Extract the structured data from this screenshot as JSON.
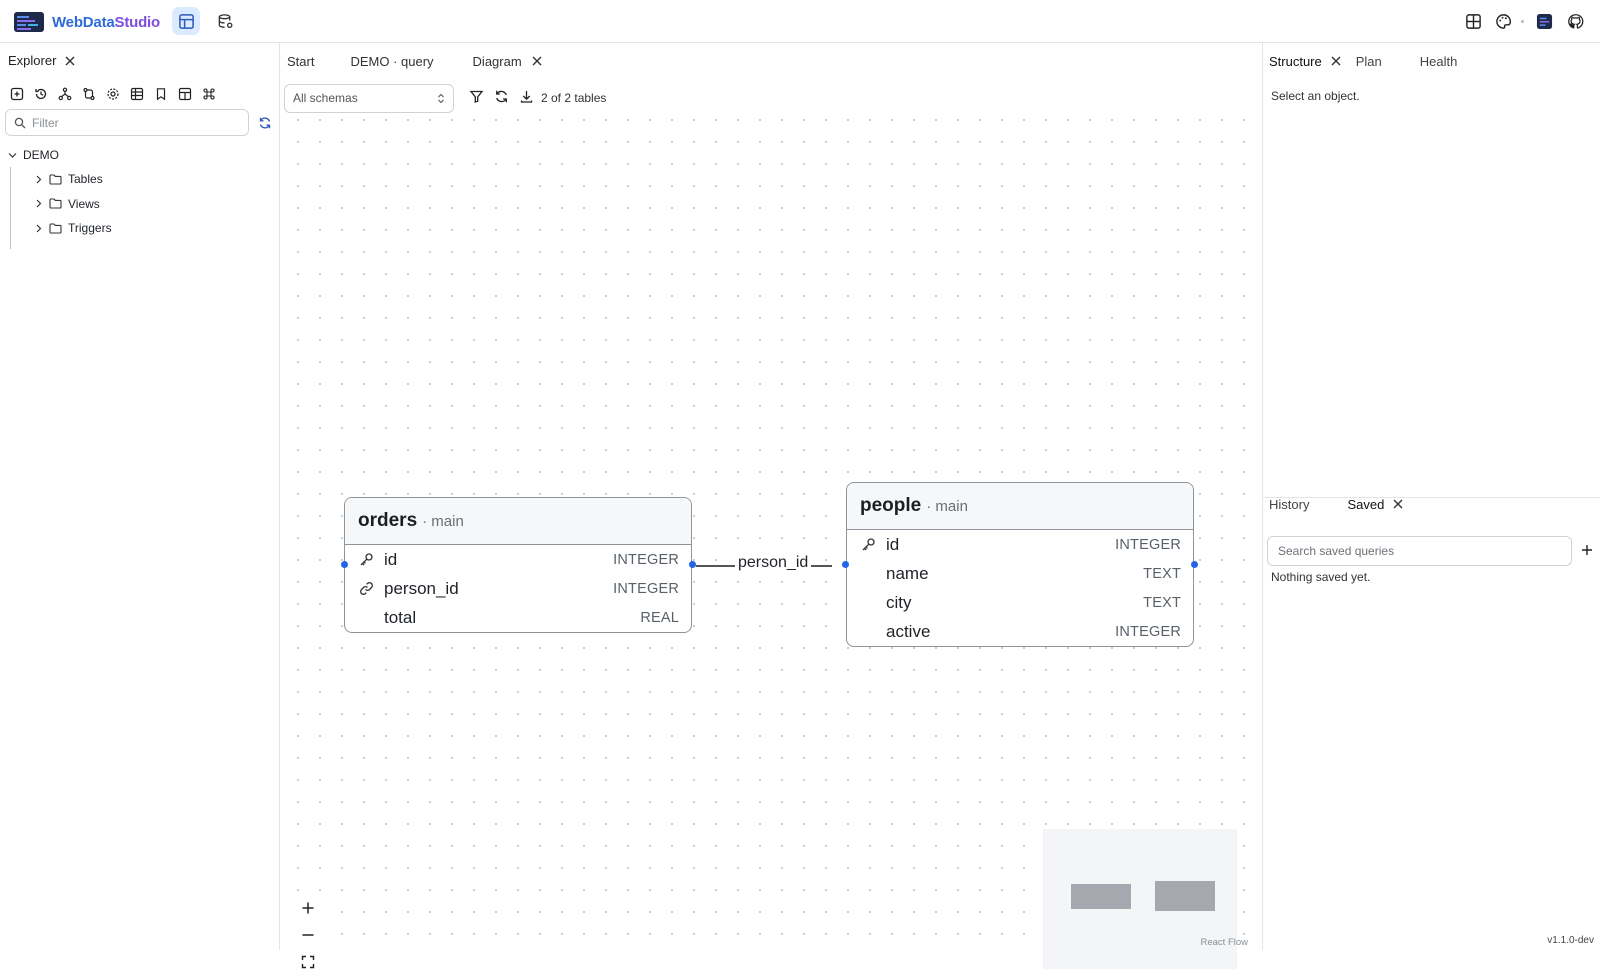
{
  "app": {
    "name_part1": "WebData",
    "name_part2": "Studio",
    "version": "v1.1.0-dev"
  },
  "explorer": {
    "title": "Explorer",
    "filter_placeholder": "Filter",
    "db_name": "DEMO",
    "folders": [
      "Tables",
      "Views",
      "Triggers"
    ]
  },
  "center": {
    "tabs": [
      "Start",
      "DEMO · query",
      "Diagram"
    ],
    "schema_select": "All schemas",
    "table_count": "2 of 2 tables"
  },
  "diagram": {
    "tables": [
      {
        "name": "orders",
        "schema": "· main",
        "columns": [
          {
            "name": "id",
            "type": "INTEGER",
            "icon": "key-icon"
          },
          {
            "name": "person_id",
            "type": "INTEGER",
            "icon": "link-icon"
          },
          {
            "name": "total",
            "type": "REAL",
            "icon": ""
          }
        ]
      },
      {
        "name": "people",
        "schema": "· main",
        "columns": [
          {
            "name": "id",
            "type": "INTEGER",
            "icon": "key-icon"
          },
          {
            "name": "name",
            "type": "TEXT",
            "icon": ""
          },
          {
            "name": "city",
            "type": "TEXT",
            "icon": ""
          },
          {
            "name": "active",
            "type": "INTEGER",
            "icon": ""
          }
        ]
      }
    ],
    "edge_label": "person_id",
    "attribution": "React Flow"
  },
  "right": {
    "top_tabs": [
      "Structure",
      "Plan",
      "Health"
    ],
    "top_message": "Select an object.",
    "bottom_tabs": [
      "History",
      "Saved"
    ],
    "saved_search_placeholder": "Search saved queries",
    "bottom_message": "Nothing saved yet."
  },
  "colors": {
    "accent": "#2563eb",
    "brand_blue": "#2f6bd8",
    "brand_purple": "#7c4ddf",
    "active_button_bg": "#dbeafe"
  }
}
